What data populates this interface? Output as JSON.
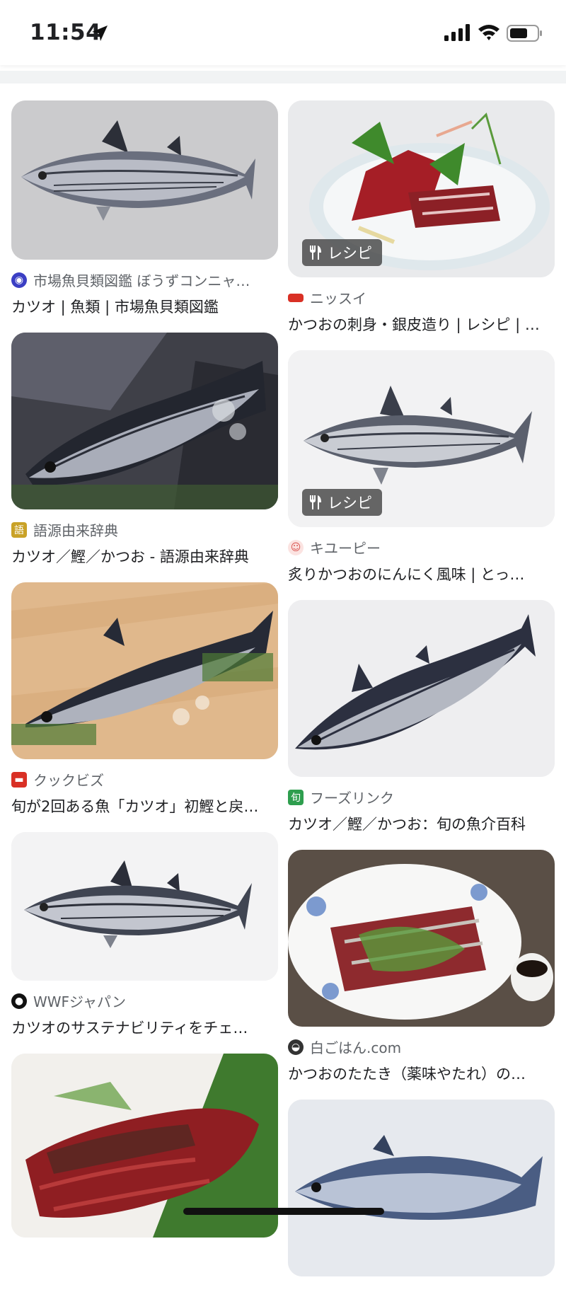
{
  "status": {
    "time": "11:54"
  },
  "recipe_badge": "レシピ",
  "left_column": [
    {
      "source": "市場魚貝類図鑑 ぼうずコンニャ…",
      "title": "カツオ | 魚類 | 市場魚貝類図鑑",
      "favicon_color": "#3b3fc4",
      "favicon_icon": "fish-circle-icon",
      "image": "skipjack-tuna-grey-background"
    },
    {
      "source": "語源由来辞典",
      "title": "カツオ／鰹／かつお - 語源由来辞典",
      "favicon_color": "#c9a227",
      "favicon_icon": "dictionary-icon",
      "image": "skipjack-tuna-on-ice-dark"
    },
    {
      "source": "クックビズ",
      "title": "旬が2回ある魚「カツオ」初鰹と戻…",
      "favicon_color": "#d93025",
      "favicon_icon": "cookbiz-icon",
      "image": "skipjack-tuna-on-wood"
    },
    {
      "source": "WWFジャパン",
      "title": "カツオのサステナビリティをチェ…",
      "favicon_color": "#111111",
      "favicon_icon": "panda-icon",
      "image": "skipjack-tuna-illustration"
    },
    {
      "source": "",
      "title": "",
      "favicon_color": "#ffffff",
      "favicon_icon": "",
      "image": "seared-bonito-slices"
    }
  ],
  "right_column": [
    {
      "source": "ニッスイ",
      "title": "かつおの刺身・銀皮造り | レシピ | …",
      "favicon_color": "#d93025",
      "favicon_icon": "nissui-icon",
      "recipe": true,
      "image": "bonito-sashimi-plate"
    },
    {
      "source": "キユーピー",
      "title": "炙りかつおのにんにく風味 | とっ…",
      "favicon_color": "#e8837c",
      "favicon_icon": "kewpie-icon",
      "recipe": true,
      "image": "skipjack-tuna-white"
    },
    {
      "source": "フーズリンク",
      "title": "カツオ／鰹／かつお：旬の魚介百科",
      "favicon_color": "#2e9e4e",
      "favicon_icon": "shun-icon",
      "recipe": false,
      "image": "skipjack-tuna-angled"
    },
    {
      "source": "白ごはん.com",
      "title": "かつおのたたき（薬味やたれ）の…",
      "favicon_color": "#333333",
      "favicon_icon": "rice-bowl-icon",
      "recipe": false,
      "image": "katsuo-tataki-plate"
    },
    {
      "source": "",
      "title": "",
      "favicon_color": "#ffffff",
      "favicon_icon": "",
      "recipe": false,
      "image": "blue-tuna-partial"
    }
  ]
}
